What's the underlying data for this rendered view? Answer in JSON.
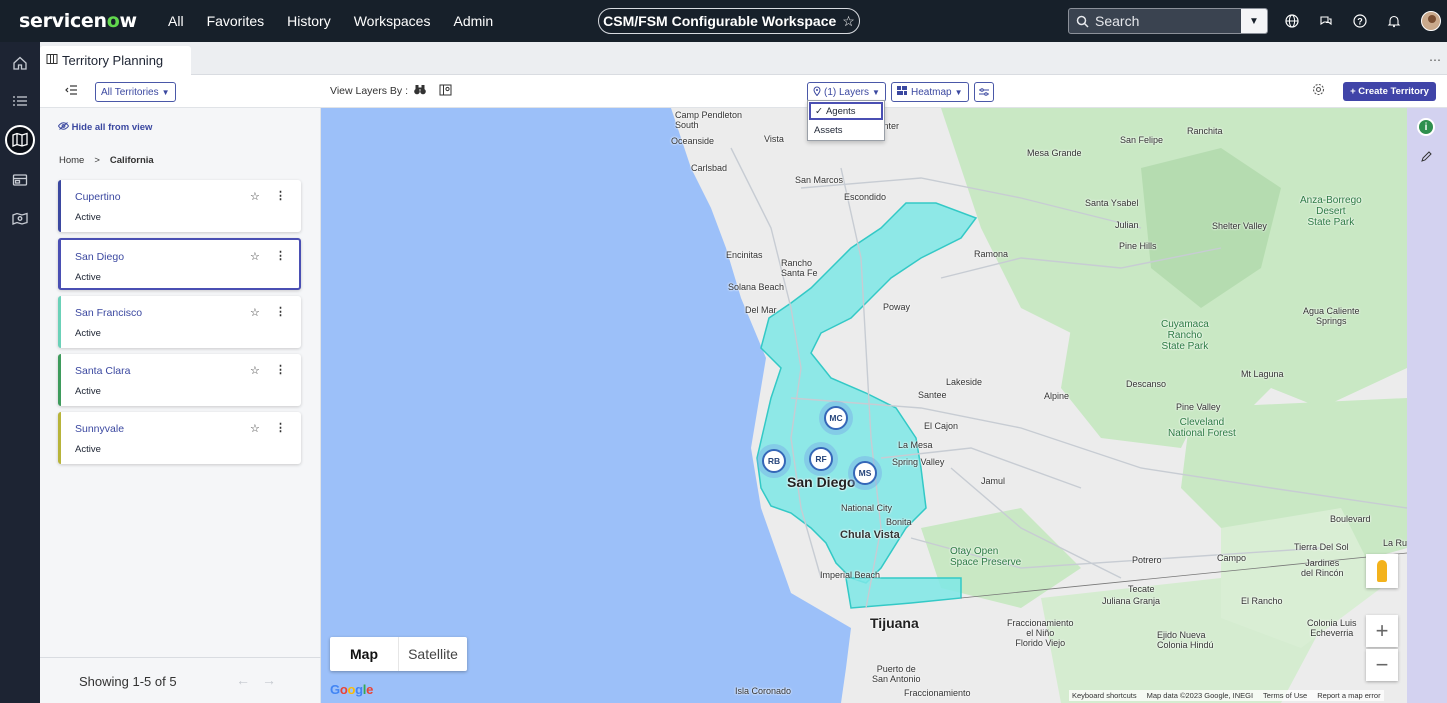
{
  "topbar": {
    "logo_prefix": "servicen",
    "logo_o": "o",
    "logo_suffix": "w",
    "nav": [
      "All",
      "Favorites",
      "History",
      "Workspaces",
      "Admin"
    ],
    "workspace": "CSM/FSM Configurable Workspace",
    "workspace_star": "☆",
    "search_placeholder": "Search"
  },
  "tab": {
    "label": "Territory Planning"
  },
  "toolbar": {
    "filter": "All Territories",
    "view_layers_by": "View Layers By :",
    "layers": "(1) Layers",
    "heatmap": "Heatmap",
    "create": "+ Create Territory"
  },
  "layers_menu": {
    "options": [
      "Agents",
      "Assets"
    ],
    "checked": "Agents"
  },
  "panel": {
    "hide_all": "Hide all from view",
    "breadcrumb": {
      "home": "Home",
      "current": "California"
    },
    "territories": [
      {
        "name": "Cupertino",
        "status": "Active",
        "color": "#3b48a0"
      },
      {
        "name": "San Diego",
        "status": "Active",
        "color": "#4a4fb3"
      },
      {
        "name": "San Francisco",
        "status": "Active",
        "color": "#6bd1b8"
      },
      {
        "name": "Santa Clara",
        "status": "Active",
        "color": "#3e9b5c"
      },
      {
        "name": "Sunnyvale",
        "status": "Active",
        "color": "#b8b43a"
      }
    ],
    "showing": "Showing 1-5 of 5"
  },
  "map": {
    "toggle": {
      "map": "Map",
      "satellite": "Satellite"
    },
    "pins": [
      "MC",
      "RB",
      "RF",
      "MS"
    ],
    "google": "Google",
    "attribution": [
      "Keyboard shortcuts",
      "Map data ©2023 Google, INEGI",
      "Terms of Use",
      "Report a map error"
    ],
    "labels": {
      "camp_pendleton": "Camp Pendleton\nSouth",
      "oceanside": "Oceanside",
      "vista": "Vista",
      "valley_center": "ley Center",
      "carlsbad": "Carlsbad",
      "san_marcos": "San Marcos",
      "escondido": "Escondido",
      "encinitas": "Encinitas",
      "rancho_santa_fe": "Rancho\nSanta Fe",
      "solana_beach": "Solana Beach",
      "del_mar": "Del Mar",
      "poway": "Poway",
      "ramona": "Ramona",
      "rancho_bernardo_label": "Rancho",
      "lakeside": "Lakeside",
      "santee": "Santee",
      "el_cajon": "El Cajon",
      "la_mesa": "La Mesa",
      "spring_valley": "Spring Valley",
      "jamul": "Jamul",
      "san_diego": "San Diego",
      "national_city": "National City",
      "bonita": "Bonita",
      "chula_vista": "Chula Vista",
      "imperial_beach": "Imperial Beach",
      "tijuana": "Tijuana",
      "otay": "Otay Open\nSpace Preserve",
      "potrero": "Potrero",
      "campo": "Campo",
      "tecate": "Tecate",
      "juliana": "Juliana Granja",
      "el_rancho": "El Rancho",
      "colonia_luis": "Colonia Luis\nEcheverria",
      "ejido_nueva": "Ejido Nueva\nColonia Hindú",
      "fraccionamiento": "Fraccionamiento\nel Niño\nFlorido Viejo",
      "puerto": "Puerto de\nSan Antonio",
      "isla": "Isla Coronado",
      "fracc2": "Fraccionamiento",
      "ranchita": "Ranchita",
      "san_felipe": "San Felipe",
      "mesa_grande": "Mesa Grande",
      "santa_ysabel": "Santa Ysabel",
      "julian": "Julian",
      "shelter_valley": "Shelter Valley",
      "anza": "Anza-Borrego\nDesert\nState Park",
      "pine_hills": "Pine Hills",
      "agua": "Agua Caliente\nSprings",
      "cuyamaca": "Cuyamaca\nRancho\nState Park",
      "mt_laguna": "Mt Laguna",
      "descanso": "Descanso",
      "alpine": "Alpine",
      "pine_valley": "Pine Valley",
      "cleveland": "Cleveland\nNational Forest",
      "boulevard": "Boulevard",
      "tierra": "Tierra Del Sol",
      "jardines": "Jardines\ndel Rincón",
      "la_rumorosa": "La Ru"
    }
  },
  "colors": {
    "brand_green": "#62d84e",
    "accent": "#4044a8",
    "territory_fill": "#7ee8e6",
    "water": "#9cc0f9"
  }
}
